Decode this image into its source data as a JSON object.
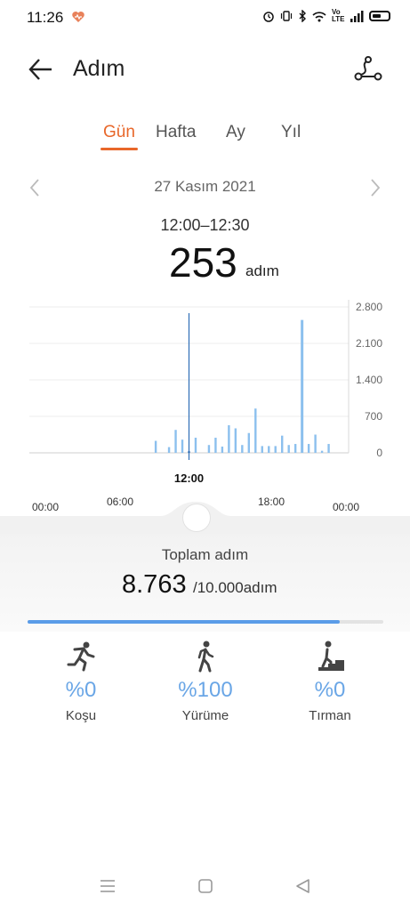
{
  "status": {
    "time": "11:26",
    "network_label": "Vo LTE"
  },
  "header": {
    "title": "Adım"
  },
  "tabs": [
    {
      "label": "Gün",
      "active": true
    },
    {
      "label": "Hafta",
      "active": false
    },
    {
      "label": "Ay",
      "active": false
    },
    {
      "label": "Yıl",
      "active": false
    }
  ],
  "date": {
    "label": "27 Kasım 2021"
  },
  "selection": {
    "time_range": "12:00–12:30",
    "value": "253",
    "unit": "adım",
    "marker_label": "12:00"
  },
  "chart_data": {
    "type": "bar",
    "y_ticks": [
      "2.800",
      "2.100",
      "1.400",
      "700",
      "0"
    ],
    "ylim": [
      0,
      2800
    ],
    "x_ticks": [
      "00:00",
      "06:00",
      "18:00",
      "00:00"
    ],
    "grid": true,
    "x": [
      9.5,
      10.5,
      11.0,
      11.5,
      12.0,
      12.5,
      13.5,
      14.0,
      14.5,
      15.0,
      15.5,
      16.0,
      16.5,
      17.0,
      17.5,
      18.0,
      18.5,
      19.0,
      19.5,
      20.0,
      20.5,
      21.0,
      21.5,
      22.0,
      22.5
    ],
    "values": [
      230,
      110,
      440,
      253,
      30,
      290,
      150,
      290,
      120,
      530,
      470,
      150,
      380,
      850,
      130,
      130,
      130,
      330,
      150,
      170,
      2550,
      170,
      350,
      40,
      170
    ],
    "selected_x": 12.0
  },
  "summary": {
    "total_label": "Toplam adım",
    "total_value": "8.763",
    "goal_text": "/10.000adım",
    "progress": 0.8763
  },
  "activities": [
    {
      "pct": "%0",
      "label": "Koşu",
      "icon": "running-icon"
    },
    {
      "pct": "%100",
      "label": "Yürüme",
      "icon": "walking-icon"
    },
    {
      "pct": "%0",
      "label": "Tırman",
      "icon": "climbing-icon"
    }
  ],
  "colors": {
    "accent": "#e8672a",
    "bar": "#8cc0ee",
    "bar_selected": "#2f6fb7",
    "progress": "#5a9ce8",
    "percent": "#6aa6e6"
  }
}
